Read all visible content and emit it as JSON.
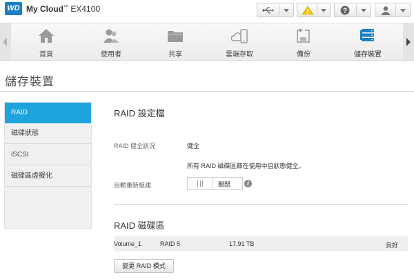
{
  "header": {
    "logo_text": "WD",
    "brand_name": "My Cloud",
    "brand_tm": "™",
    "model": "EX4100",
    "accent": "#1b7fc4"
  },
  "toolbar": {
    "usb_icon": "usb-icon",
    "alert_icon": "warning-icon",
    "help_icon": "help-icon",
    "user_icon": "user-icon"
  },
  "nav": {
    "items": [
      {
        "label": "首頁",
        "icon": "home-icon"
      },
      {
        "label": "使用者",
        "icon": "users-icon"
      },
      {
        "label": "共享",
        "icon": "folder-icon"
      },
      {
        "label": "雲端存取",
        "icon": "cloud-device-icon"
      },
      {
        "label": "備份",
        "icon": "backup-icon"
      },
      {
        "label": "儲存裝置",
        "icon": "storage-icon",
        "active": true
      }
    ]
  },
  "page": {
    "title": "儲存裝置"
  },
  "sidebar": {
    "items": [
      {
        "label": "RAID",
        "active": true
      },
      {
        "label": "磁碟狀態"
      },
      {
        "label": "iSCSI"
      },
      {
        "label": "磁碟區虛擬化"
      }
    ],
    "active_color": "#1ea3dc"
  },
  "raid_profile": {
    "title": "RAID 設定檔",
    "health_label": "RAID 健全狀況",
    "health_value": "健全",
    "health_note": "所有 RAID 磁碟區都在使用中且狀態健全。",
    "auto_rebuild_label": "自動重新組建",
    "auto_rebuild_value": "關閉"
  },
  "raid_volumes": {
    "title": "RAID 磁碟區",
    "rows": [
      {
        "name": "Volume_1",
        "raid": "RAID 5",
        "size": "17.91 TB",
        "status": "良好"
      }
    ],
    "change_button": "變更 RAID 模式"
  }
}
